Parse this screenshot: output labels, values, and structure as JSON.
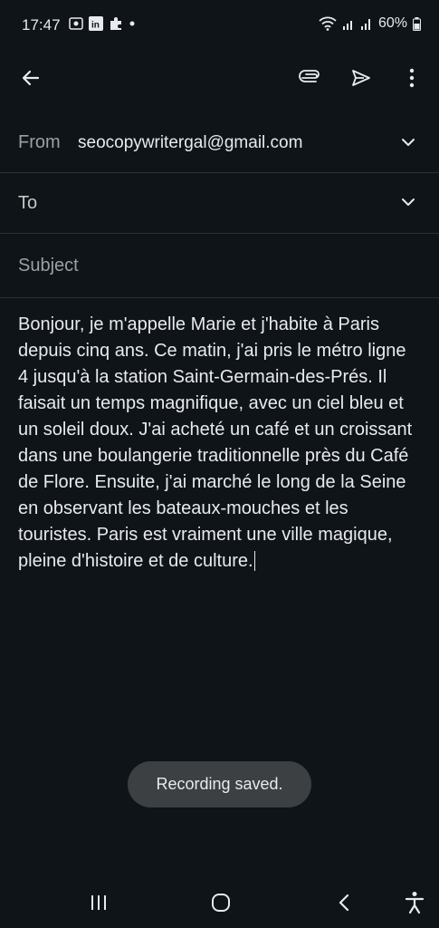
{
  "status_bar": {
    "time": "17:47",
    "battery_percent": "60%",
    "icons": [
      "screen-record-icon",
      "linkedin-icon",
      "puzzle-icon",
      "dot-icon",
      "wifi-icon",
      "signal-icon",
      "signal-icon-2",
      "battery-icon"
    ]
  },
  "toolbar": {
    "icons": [
      "back-arrow-icon",
      "attach-icon",
      "send-icon",
      "more-vert-icon"
    ]
  },
  "compose": {
    "from_label": "From",
    "from_value": "seocopywritergal@gmail.com",
    "to_label": "To",
    "subject_placeholder": "Subject",
    "body": "Bonjour, je m'appelle Marie et j'habite à Paris depuis cinq ans. Ce matin, j'ai pris le métro ligne 4 jusqu'à la station Saint-Germain-des-Prés. Il faisait un temps magnifique, avec un ciel bleu et un soleil doux. J'ai acheté un café et un croissant dans une boulangerie traditionnelle près du Café de Flore. Ensuite, j'ai marché le long de la Seine en observant les bateaux-mouches et les touristes. Paris est vraiment une ville magique, pleine d'histoire et de culture."
  },
  "toast": {
    "message": "Recording saved."
  },
  "nav_bar": {
    "icons": [
      "recents-icon",
      "home-icon",
      "back-icon",
      "accessibility-icon"
    ]
  },
  "colors": {
    "background": "#0f1419",
    "text": "#e8eaed",
    "muted": "#9aa0a6",
    "toast_bg": "#3c4043"
  }
}
